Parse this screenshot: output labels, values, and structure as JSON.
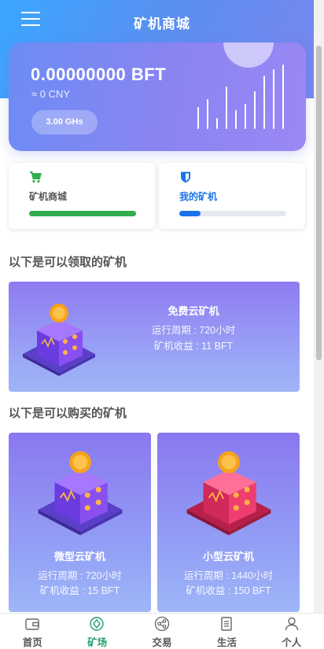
{
  "header": {
    "title": "矿机商城"
  },
  "balance": {
    "amount": "0.00000000 BFT",
    "cny": "≈ 0 CNY",
    "hashrate": "3.00 GHs"
  },
  "tiles": [
    {
      "label": "矿机商城",
      "color": "#2fae4e",
      "icon": "cart-icon",
      "progress": 1.0
    },
    {
      "label": "我的矿机",
      "color": "#1a73e8",
      "icon": "shield-icon",
      "progress": 0.2
    }
  ],
  "sections": {
    "claimable": "以下是可以领取的矿机",
    "purchasable": "以下是可以购买的矿机"
  },
  "free_miner": {
    "name": "免费云矿机",
    "period": "运行周期 : 720小时",
    "income": "矿机收益 : 11 BFT"
  },
  "shop_miners": [
    {
      "name": "微型云矿机",
      "period": "运行周期 : 720小时",
      "income": "矿机收益 : 15 BFT",
      "accent": "#7c3ee0"
    },
    {
      "name": "小型云矿机",
      "period": "运行周期 : 1440小时",
      "income": "矿机收益 : 150 BFT",
      "accent": "#e03a6a"
    }
  ],
  "tabbar": [
    {
      "label": "首页",
      "icon": "wallet-icon",
      "active": false
    },
    {
      "label": "矿场",
      "icon": "mining-icon",
      "active": true
    },
    {
      "label": "交易",
      "icon": "share-icon",
      "active": false
    },
    {
      "label": "生活",
      "icon": "document-icon",
      "active": false
    },
    {
      "label": "个人",
      "icon": "user-icon",
      "active": false
    }
  ],
  "colors": {
    "accent": "#1f9e6a",
    "hero": "#3aa7ff",
    "card": "#8a84f2"
  }
}
